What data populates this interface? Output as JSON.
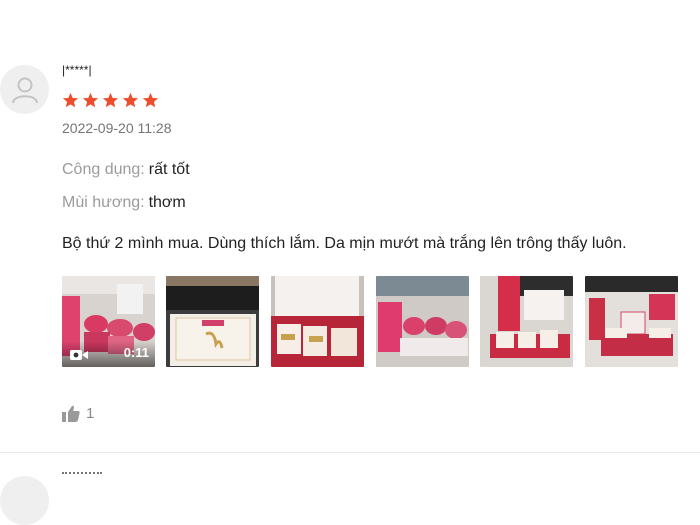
{
  "review": {
    "username": "|*****|",
    "rating": 5,
    "rating_max": 5,
    "star_color": "#ee4d2d",
    "timestamp": "2022-09-20 11:28",
    "attributes": [
      {
        "label": "Công dụng:",
        "value": "rất tốt"
      },
      {
        "label": "Mùi hương:",
        "value": "thơm"
      }
    ],
    "comment": "Bộ thứ 2 mình mua.  Dùng thích lắm.  Da mịn mướt mà trắng lên trông thấy luôn.",
    "media": {
      "video_duration": "0:11",
      "video_icon": "video-camera-icon",
      "image_count": 6
    },
    "likes": {
      "icon": "thumbs-up-icon",
      "count": "1"
    }
  }
}
